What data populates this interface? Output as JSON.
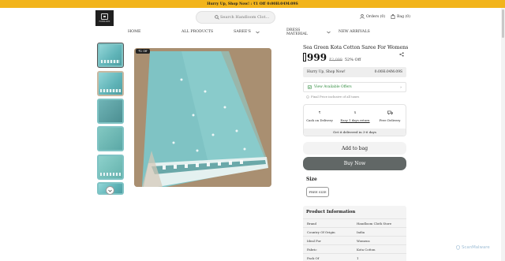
{
  "announcement": {
    "text": "Hurry Up, Shop Now! : ₹1 Off",
    "timer": "0:00H:04M:09S"
  },
  "header": {
    "logo_text": "HANDLOOM",
    "search_placeholder": "Search Handloom Clot...",
    "orders_label": "Orders (0)",
    "bag_label": "Bag (0)"
  },
  "nav": {
    "home": "HOME",
    "all_products": "ALL PRODUCTS",
    "sarees": "SAREE'S",
    "dress_material_1": "DRESS",
    "dress_material_2": "MATERIAL",
    "new_arrivals": "NEW ARRIVALS"
  },
  "gallery": {
    "badge": "₹1 Off"
  },
  "product": {
    "title": "Sea Green Kota Cotton Saree For Womens",
    "price": "999",
    "mrp": "₹2,099",
    "discount": "52% Off"
  },
  "hurry": {
    "text": "Hurry Up, Shop Now!",
    "timer": "0:00H:04M:09S"
  },
  "offers": {
    "label": "View Available Offers",
    "tax_note": "Final Price inclusive of all taxes"
  },
  "delivery": {
    "cod": "Cash on Delivery",
    "returns": "Easy 1 days return",
    "free": "Free Delivery",
    "eta": "Get it delivered in 3-6 days"
  },
  "actions": {
    "add_to_bag": "Add to bag",
    "buy_now": "Buy Now"
  },
  "size": {
    "label": "Size",
    "option": "FREE SIZE"
  },
  "info": {
    "title": "Product Information",
    "rows": [
      {
        "key": "Brand",
        "value": "Handloom Cloth Store"
      },
      {
        "key": "Country Of Origin",
        "value": "India"
      },
      {
        "key": "Ideal For",
        "value": "Womens"
      },
      {
        "key": "Fabric",
        "value": "Kota Cotton"
      },
      {
        "key": "Pack Of",
        "value": "1"
      }
    ]
  },
  "watermark": "ScanMalware",
  "colors": {
    "accent_bar": "#f2b41b",
    "buy_button": "#616766",
    "offer_green": "#2e8b3d",
    "saree": "#7fc3c4"
  }
}
